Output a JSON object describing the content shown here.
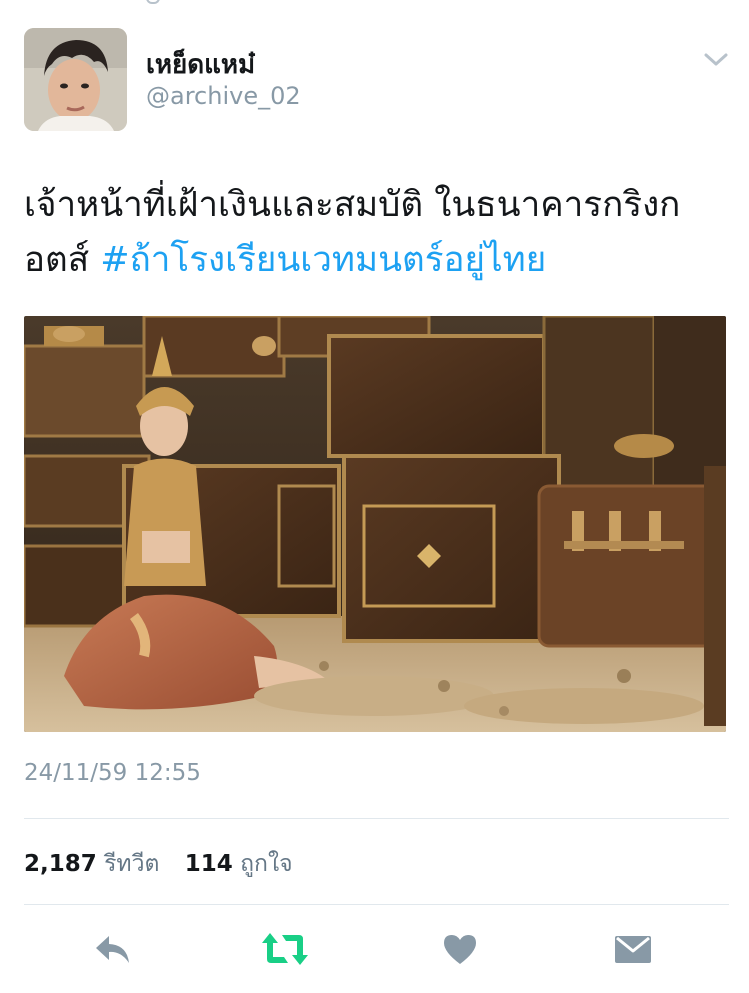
{
  "author": {
    "display_name": "เหย็ดแหม๋",
    "handle": "@archive_02"
  },
  "tweet": {
    "text": "เจ้าหน้าที่เฝ้าเงินและสมบัติ ในธนาคารกริงกอตส์ ",
    "hashtag": "#ถ้าโรงเรียนเวทมนตร์อยู่ไทย",
    "timestamp": "24/11/59 12:55"
  },
  "stats": {
    "retweets_count": "2,187",
    "retweets_label": "รีทวีต",
    "likes_count": "114",
    "likes_label": "ถูกใจ"
  },
  "icons": {
    "caret": "chevron-down-icon",
    "reply": "reply-icon",
    "retweet": "retweet-icon",
    "like": "heart-icon",
    "message": "envelope-icon"
  },
  "colors": {
    "hashtag": "#1da1f2",
    "retweet_active": "#19cf86",
    "icon_gray": "#8899a6",
    "secondary_text": "#8899a6"
  }
}
